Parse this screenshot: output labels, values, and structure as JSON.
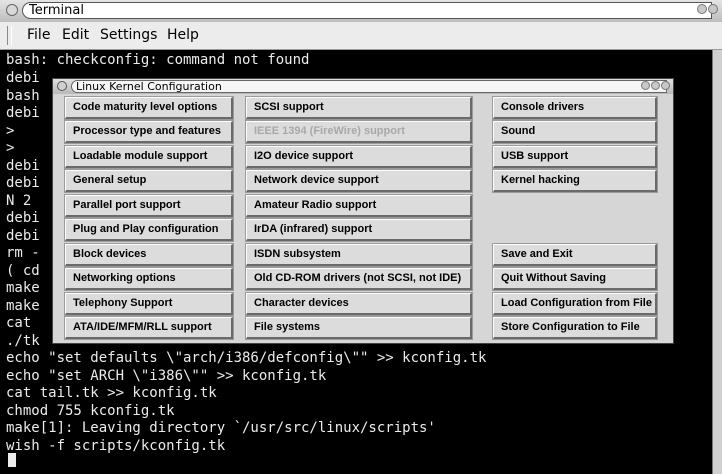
{
  "terminal": {
    "title": "Terminal",
    "menu": [
      "File",
      "Edit",
      "Settings",
      "Help"
    ],
    "lines": [
      "bash: checkconfig: command not found",
      "debi",
      "bash",
      "debi",
      ">",
      ">",
      "debi",
      "debi",
      "N 2",
      "debi",
      "debi",
      "rm -",
      "( cd",
      "make",
      "make",
      "cat",
      "./tk",
      "echo \"set defaults \\\"arch/i386/defconfig\\\"\" >> kconfig.tk",
      "echo \"set ARCH \\\"i386\\\"\" >> kconfig.tk",
      "cat tail.tk >> kconfig.tk",
      "chmod 755 kconfig.tk",
      "make[1]: Leaving directory `/usr/src/linux/scripts'",
      "wish -f scripts/kconfig.tk"
    ]
  },
  "dialog": {
    "title": "Linux Kernel Configuration",
    "column1": [
      "Code maturity level options",
      "Processor type and features",
      "Loadable module support",
      "General setup",
      "Parallel port support",
      "Plug and Play configuration",
      "Block devices",
      "Networking options",
      "Telephony Support",
      "ATA/IDE/MFM/RLL support"
    ],
    "column2": [
      "SCSI support",
      "IEEE 1394 (FireWire) support",
      "I2O device support",
      "Network device support",
      "Amateur Radio support",
      "IrDA (infrared) support",
      "ISDN subsystem",
      "Old CD-ROM drivers (not SCSI, not IDE)",
      "Character devices",
      "File systems"
    ],
    "column3_top": [
      "Console drivers",
      "Sound",
      "USB support",
      "Kernel hacking"
    ],
    "column3_bottom": [
      "Save and Exit",
      "Quit Without Saving",
      "Load Configuration from File",
      "Store Configuration to File"
    ]
  }
}
